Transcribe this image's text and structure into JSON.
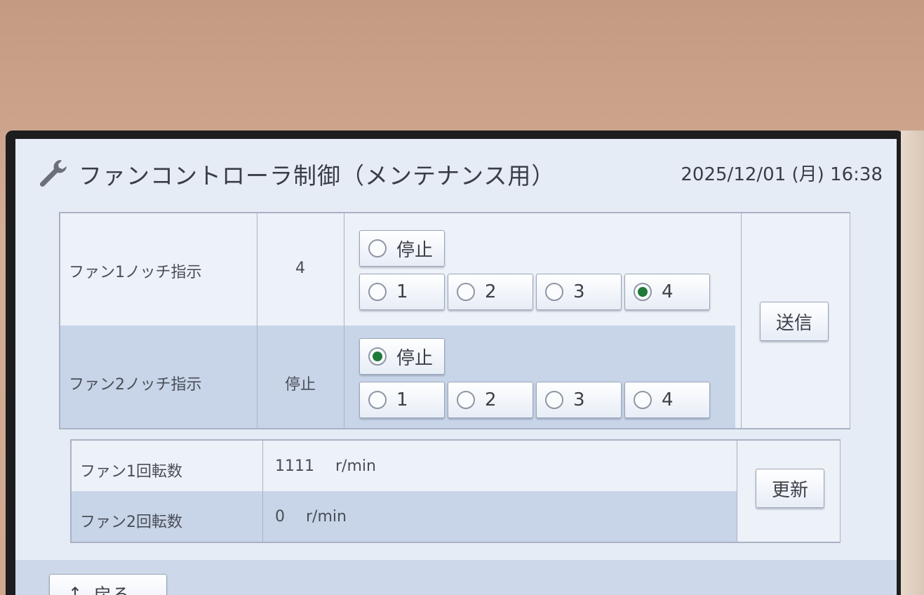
{
  "header": {
    "title": "ファンコントローラ制御（メンテナンス用）",
    "datetime": "2025/12/01 (月) 16:38",
    "icon": "wrench-icon"
  },
  "fan_notch": {
    "rows": [
      {
        "label": "ファン1ノッチ指示",
        "current_value": "4",
        "stop_label": "停止",
        "options": [
          "1",
          "2",
          "3",
          "4"
        ],
        "selected": "4"
      },
      {
        "label": "ファン2ノッチ指示",
        "current_value": "停止",
        "stop_label": "停止",
        "options": [
          "1",
          "2",
          "3",
          "4"
        ],
        "selected": "停止"
      }
    ],
    "send_button": "送信"
  },
  "fan_rpm": {
    "rows": [
      {
        "label": "ファン1回転数",
        "value": "1111",
        "unit": "r/min"
      },
      {
        "label": "ファン2回転数",
        "value": "0",
        "unit": "r/min"
      }
    ],
    "refresh_button": "更新"
  },
  "footer": {
    "back_button": "戻る",
    "back_icon": "up-arrow-icon"
  },
  "colors": {
    "screen_bg": "#e6ecf6",
    "row_highlight": "#c8d5e8",
    "radio_selected": "#1f7a3a",
    "text": "#3c3f48"
  }
}
